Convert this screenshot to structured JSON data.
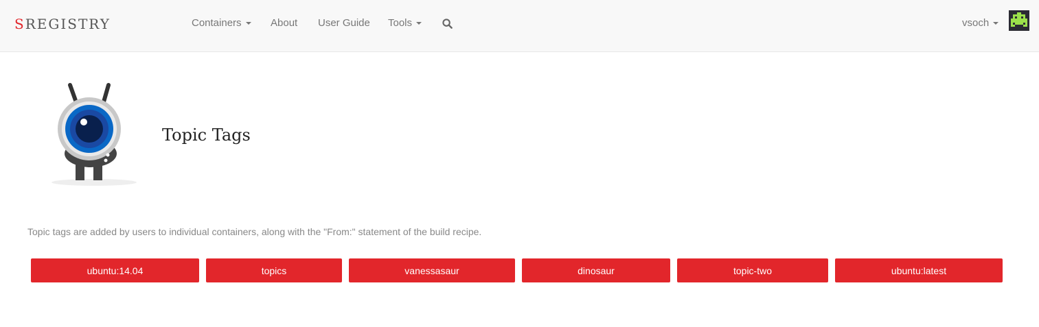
{
  "brand": {
    "first_letter": "S",
    "rest": "REGISTRY"
  },
  "nav": {
    "containers": "Containers",
    "about": "About",
    "user_guide": "User Guide",
    "tools": "Tools"
  },
  "user": {
    "name": "vsoch"
  },
  "page": {
    "title": "Topic Tags",
    "description": "Topic tags are added by users to individual containers, along with the \"From:\" statement of the build recipe."
  },
  "tags": [
    "ubuntu:14.04",
    "topics",
    "vanessasaur",
    "dinosaur",
    "topic-two",
    "ubuntu:latest"
  ],
  "colors": {
    "accent": "#e2262b",
    "navbar_bg": "#f8f8f8",
    "avatar_green": "#9be14b"
  },
  "icons": {
    "search": "search-icon",
    "logo": "robot-eye-logo",
    "avatar": "pixel-invader-avatar"
  }
}
